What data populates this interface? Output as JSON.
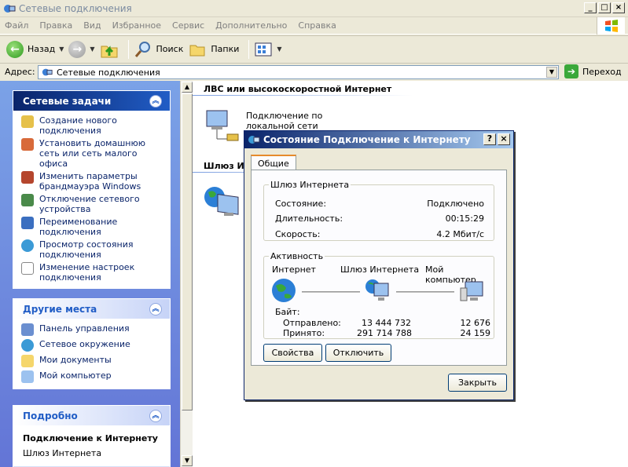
{
  "window": {
    "title": "Сетевые подключения",
    "min": "_",
    "max": "□",
    "close": "×"
  },
  "menu": [
    "Файл",
    "Правка",
    "Вид",
    "Избранное",
    "Сервис",
    "Дополнительно",
    "Справка"
  ],
  "toolbar": {
    "back": "Назад",
    "search": "Поиск",
    "folders": "Папки"
  },
  "address": {
    "label": "Адрес:",
    "value": "Сетевые подключения",
    "go": "Переход"
  },
  "tasks": {
    "title": "Сетевые задачи",
    "items": [
      "Создание нового подключения",
      "Установить домашнюю сеть или сеть малого офиса",
      "Изменить параметры брандмауэра Windows",
      "Отключение сетевого устройства",
      "Переименование подключения",
      "Просмотр состояния подключения",
      "Изменение настроек подключения"
    ]
  },
  "places": {
    "title": "Другие места",
    "items": [
      "Панель управления",
      "Сетевое окружение",
      "Мои документы",
      "Мой компьютер"
    ]
  },
  "details": {
    "title": "Подробно",
    "name": "Подключение к Интернету",
    "type": "Шлюз Интернета"
  },
  "content": {
    "group1": "ЛВС или высокоскоростной Интернет",
    "conn1": "Подключение по локальной сети",
    "group2": "Шлюз Ин"
  },
  "dialog": {
    "title": "Состояние Подключение к Интернету",
    "help": "?",
    "close": "×",
    "tab": "Общие",
    "gateway": {
      "legend": "Шлюз Интернета",
      "state_label": "Состояние:",
      "state_value": "Подключено",
      "duration_label": "Длительность:",
      "duration_value": "00:15:29",
      "speed_label": "Скорость:",
      "speed_value": "4.2 Мбит/с"
    },
    "activity": {
      "legend": "Активность",
      "internet": "Интернет",
      "gateway": "Шлюз Интернета",
      "computer": "Мой компьютер",
      "bytes": "Байт:",
      "sent_label": "Отправлено:",
      "sent_internet": "13 444 732",
      "sent_computer": "12 676",
      "recv_label": "Принято:",
      "recv_internet": "291 714 788",
      "recv_computer": "24 159"
    },
    "props_button": "Свойства",
    "disconnect_button": "Отключить",
    "close_button": "Закрыть"
  }
}
